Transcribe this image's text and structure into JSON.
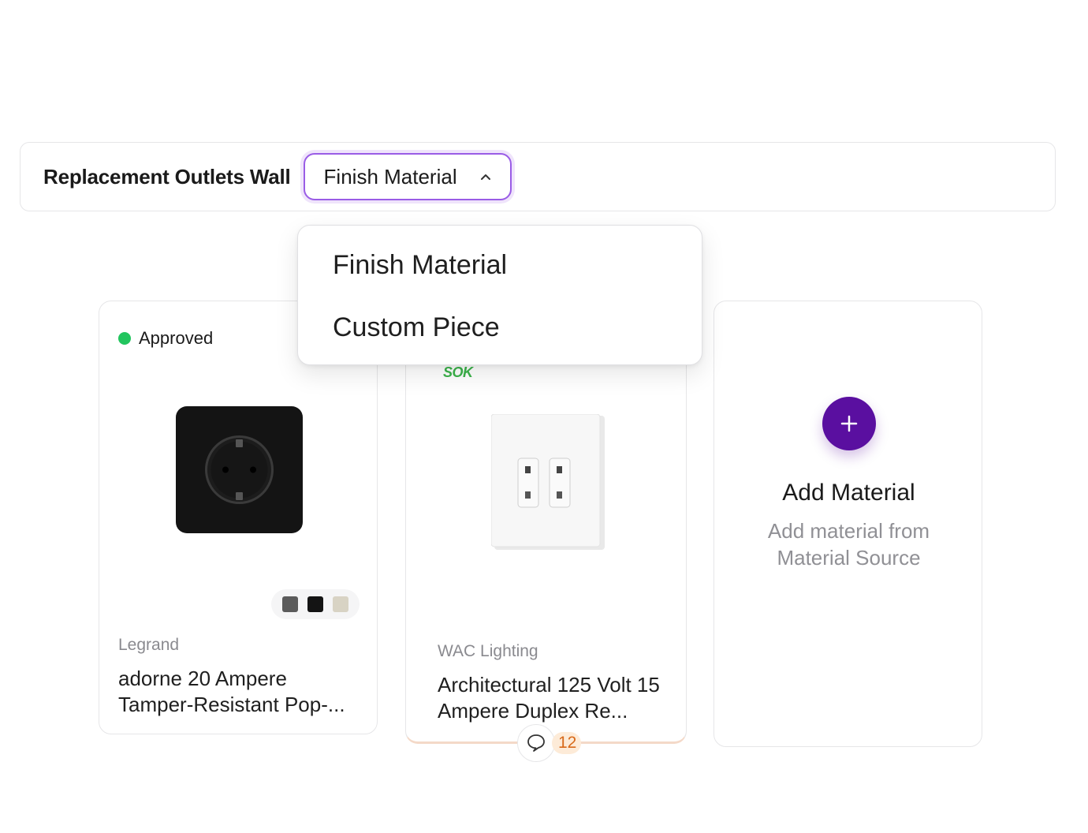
{
  "toolbar": {
    "title": "Replacement Outlets Wall",
    "type_select": {
      "value": "Finish Material",
      "icon": "chevron-up-icon"
    }
  },
  "dropdown": {
    "options": [
      "Finish Material",
      "Custom Piece"
    ]
  },
  "cards": [
    {
      "status": "Approved",
      "status_color": "#22c55e",
      "brand": "Legrand",
      "name": "adorne 20 Ampere Tamper-Resistant Pop-...",
      "swatches": [
        "#5b5b5b",
        "#141414",
        "#d8d3c4"
      ]
    },
    {
      "logo": "SOK",
      "brand": "WAC Lighting",
      "name": "Architectural 125 Volt 15 Ampere Duplex Re...",
      "comments": "12"
    }
  ],
  "add_material": {
    "title": "Add Material",
    "subtitle": "Add material from Material Source",
    "accent": "#5a0fa0"
  }
}
